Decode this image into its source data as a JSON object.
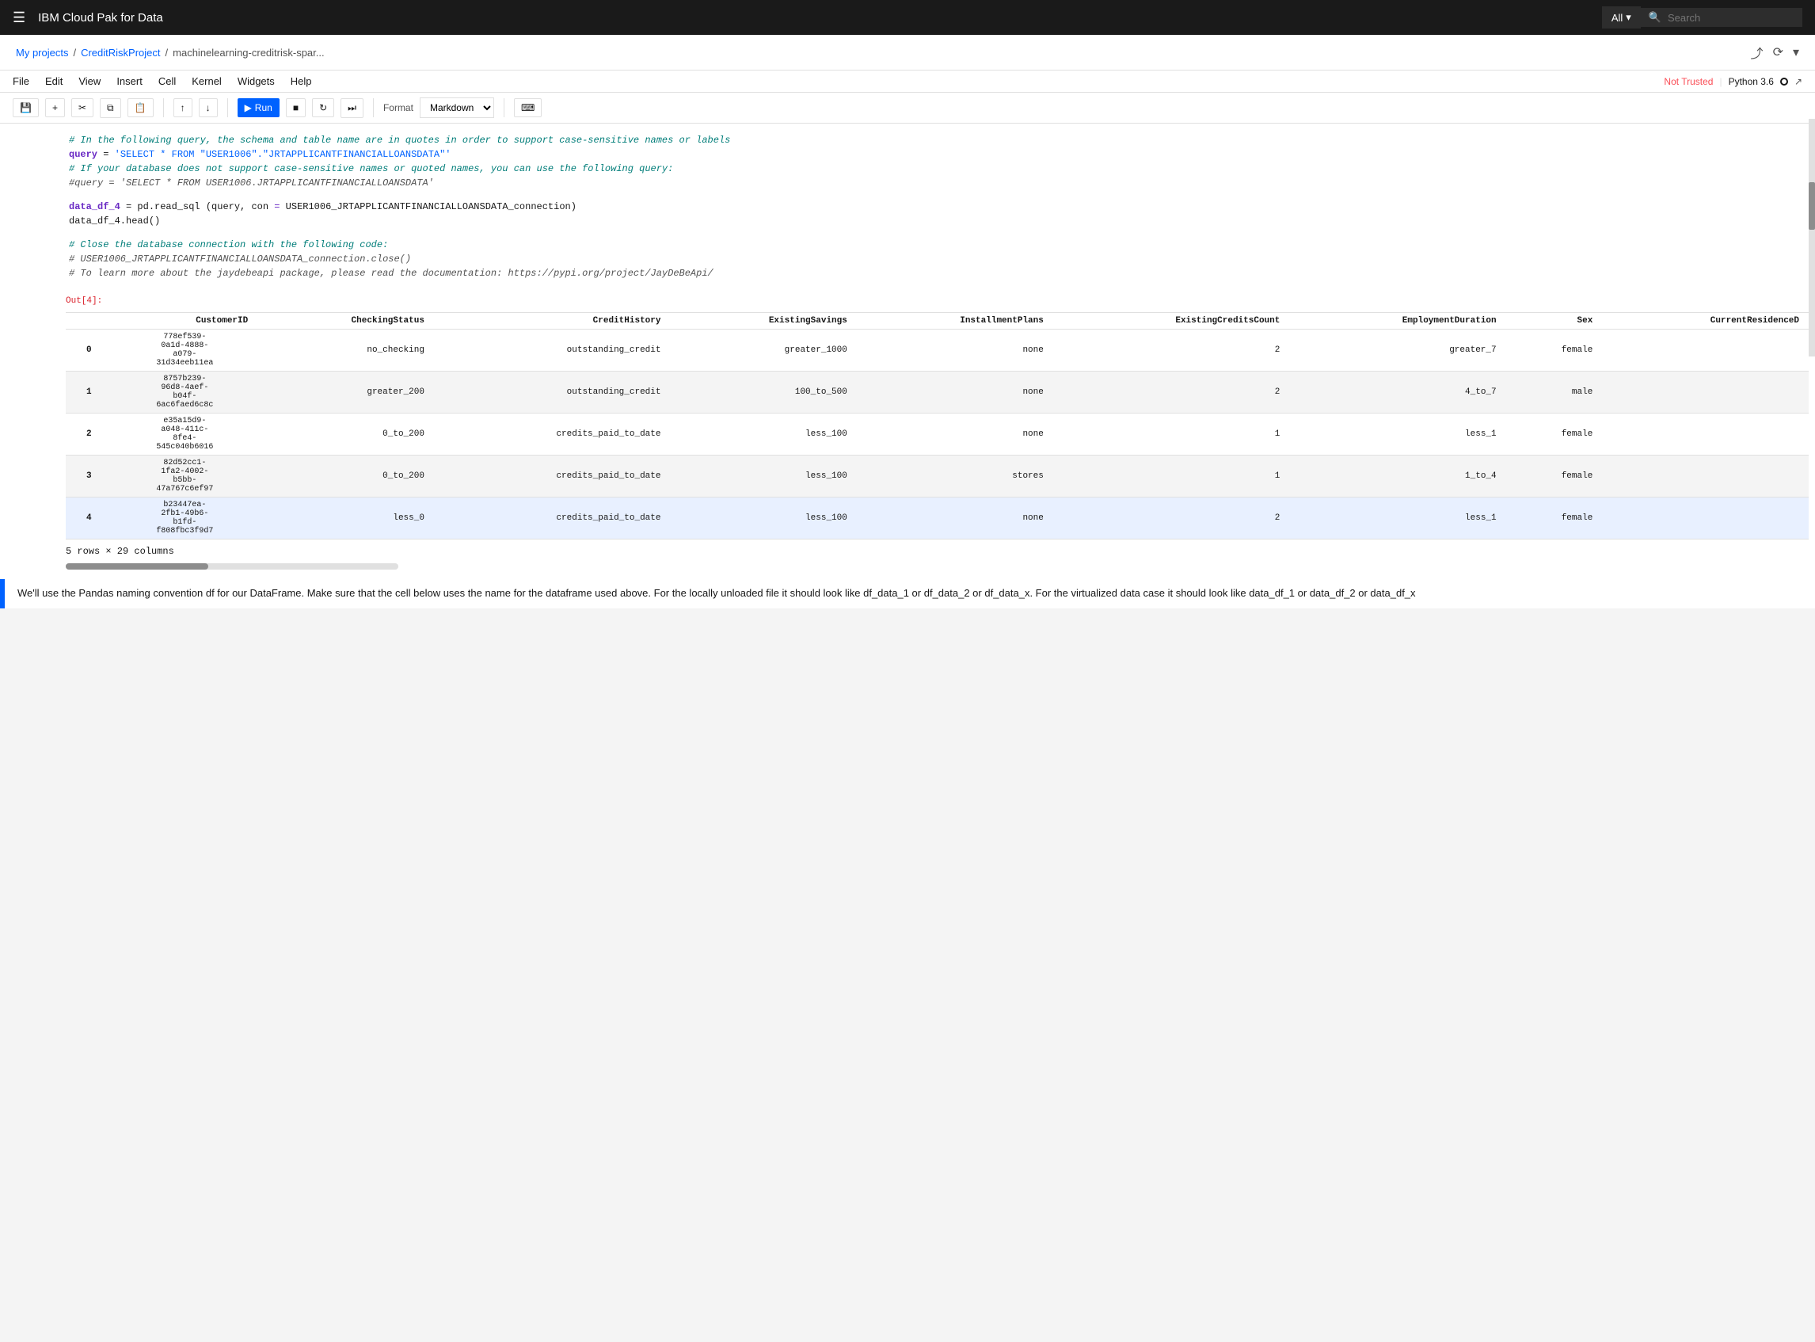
{
  "app": {
    "title": "IBM Cloud Pak for Data",
    "search_placeholder": "Search",
    "search_dropdown_label": "All"
  },
  "breadcrumb": {
    "project": "My projects",
    "separator1": "/",
    "notebook": "CreditRiskProject",
    "separator2": "/",
    "current": "machinelearning-creditrisk-spar..."
  },
  "menubar": {
    "items": [
      "File",
      "Edit",
      "View",
      "Insert",
      "Cell",
      "Kernel",
      "Widgets",
      "Help"
    ],
    "trust_label": "Not Trusted",
    "kernel_label": "Python 3.6"
  },
  "toolbar": {
    "run_label": "Run",
    "format_label": "Format",
    "format_value": "Markdown"
  },
  "code_cell": {
    "label": "",
    "line1": "# In the following query, the schema and table name are in quotes in order to support case-sensitive names or labels",
    "line2a": "query",
    "line2b": " = ",
    "line2c": "'SELECT * FROM \"USER1006\".\"JRTAPPLICANTFINANCIALLOANSDATA\"'",
    "line3": "# If your database does not support case-sensitive names or quoted names, you can use the following query:",
    "line4": "#query = 'SELECT * FROM USER1006.JRTAPPLICANTFINANCIALLOANSDATA'",
    "line5a": "data_df_4",
    "line5b": " = ",
    "line5c": "pd.read_sql",
    "line5d": "(query, con=USER1006_JRTAPPLICANTFINANCIALLOANSDATA_connection)",
    "line6": "data_df_4.head()",
    "line7": "# Close the database connection with the following code:",
    "line8": "# USER1006_JRTAPPLICANTFINANCIALLOANSDATA_connection.close()",
    "line9": "# To learn more about the jaydebeapi package, please read the documentation: https://pypi.org/project/JayDeBeApi/"
  },
  "output": {
    "label": "Out[4]:",
    "table": {
      "columns": [
        "CustomerID",
        "CheckingStatus",
        "CreditHistory",
        "ExistingSavings",
        "InstallmentPlans",
        "ExistingCreditsCount",
        "EmploymentDuration",
        "Sex",
        "CurrentResidenceD"
      ],
      "rows": [
        {
          "idx": "0",
          "CustomerID": "778ef539-\n0a1d-4888-\na079-\n31d34eeb11ea",
          "CheckingStatus": "no_checking",
          "CreditHistory": "outstanding_credit",
          "ExistingSavings": "greater_1000",
          "InstallmentPlans": "none",
          "ExistingCreditsCount": "2",
          "EmploymentDuration": "greater_7",
          "Sex": "female",
          "CurrentResidenceD": ""
        },
        {
          "idx": "1",
          "CustomerID": "8757b239-\n96d8-4aef-\nb04f-\n6ac6faed6c8c",
          "CheckingStatus": "greater_200",
          "CreditHistory": "outstanding_credit",
          "ExistingSavings": "100_to_500",
          "InstallmentPlans": "none",
          "ExistingCreditsCount": "2",
          "EmploymentDuration": "4_to_7",
          "Sex": "male",
          "CurrentResidenceD": ""
        },
        {
          "idx": "2",
          "CustomerID": "e35a15d9-\na048-411c-\n8fe4-\n545c040b6016",
          "CheckingStatus": "0_to_200",
          "CreditHistory": "credits_paid_to_date",
          "ExistingSavings": "less_100",
          "InstallmentPlans": "none",
          "ExistingCreditsCount": "1",
          "EmploymentDuration": "less_1",
          "Sex": "female",
          "CurrentResidenceD": ""
        },
        {
          "idx": "3",
          "CustomerID": "82d52cc1-\n1fa2-4002-\nb5bb-\n47a767c6ef97",
          "CheckingStatus": "0_to_200",
          "CreditHistory": "credits_paid_to_date",
          "ExistingSavings": "less_100",
          "InstallmentPlans": "stores",
          "ExistingCreditsCount": "1",
          "EmploymentDuration": "1_to_4",
          "Sex": "female",
          "CurrentResidenceD": ""
        },
        {
          "idx": "4",
          "CustomerID": "b23447ea-\n2fb1-49b6-\nb1fd-\nf808fbc3f9d7",
          "CheckingStatus": "less_0",
          "CreditHistory": "credits_paid_to_date",
          "ExistingSavings": "less_100",
          "InstallmentPlans": "none",
          "ExistingCreditsCount": "2",
          "EmploymentDuration": "less_1",
          "Sex": "female",
          "CurrentResidenceD": ""
        }
      ]
    },
    "rows_cols": "5 rows × 29 columns"
  },
  "markdown_cell": {
    "text": "We'll use the Pandas naming convention df for our DataFrame. Make sure that the cell below uses the name for the dataframe used above. For the locally unloaded file it should look like df_data_1 or df_data_2 or df_data_x. For the virtualized data case it should look like data_df_1 or data_df_2 or data_df_x"
  }
}
